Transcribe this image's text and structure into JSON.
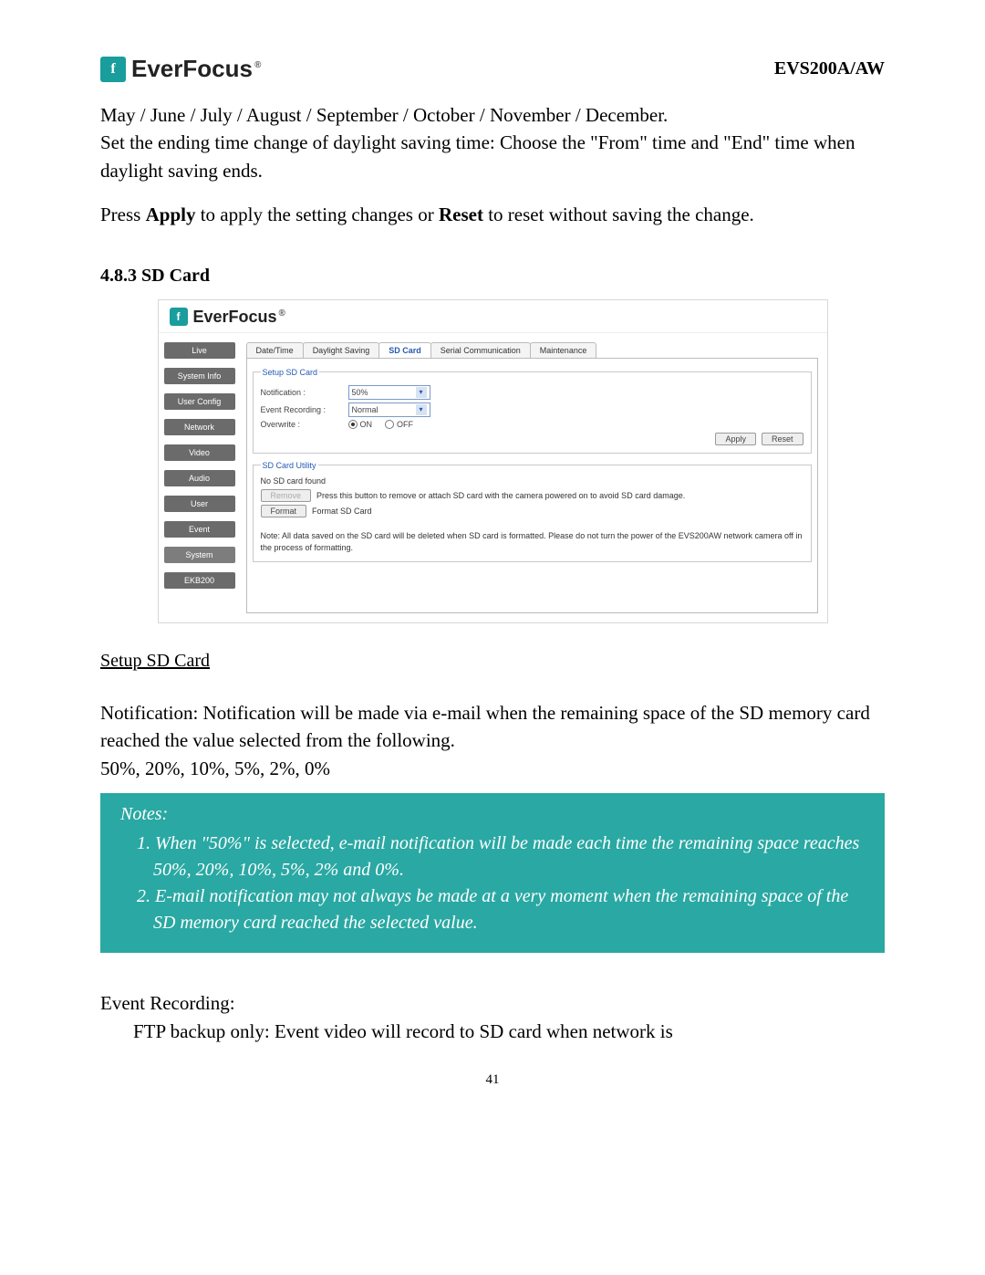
{
  "header": {
    "brand": "EverFocus",
    "model": "EVS200A/AW"
  },
  "text": {
    "para1": "May / June / July / August / September / October / November / December.",
    "para2": "Set the ending time change of daylight saving time: Choose the \"From\" time and \"End\" time when daylight saving ends.",
    "press_pre": "Press ",
    "press_apply": "Apply",
    "press_mid": " to apply the setting changes or ",
    "press_reset": "Reset",
    "press_post": " to reset without saving the change."
  },
  "section": {
    "number": "4.8.3",
    "title": "SD Card"
  },
  "screenshot": {
    "brand": "EverFocus",
    "sidebar": {
      "items": [
        {
          "label": "Live"
        },
        {
          "label": "System Info"
        },
        {
          "label": "User Config"
        },
        {
          "label": "Network"
        },
        {
          "label": "Video"
        },
        {
          "label": "Audio"
        },
        {
          "label": "User"
        },
        {
          "label": "Event"
        },
        {
          "label": "System"
        },
        {
          "label": "EKB200"
        }
      ]
    },
    "tabs": {
      "items": [
        {
          "label": "Date/Time"
        },
        {
          "label": "Daylight Saving"
        },
        {
          "label": "SD Card"
        },
        {
          "label": "Serial Communication"
        },
        {
          "label": "Maintenance"
        }
      ],
      "active_index": 2
    },
    "setup": {
      "legend": "Setup SD Card",
      "notification_label": "Notification :",
      "notification_value": "50%",
      "event_recording_label": "Event Recording :",
      "event_recording_value": "Normal",
      "overwrite_label": "Overwrite :",
      "overwrite_on": "ON",
      "overwrite_off": "OFF",
      "apply_label": "Apply",
      "reset_label": "Reset"
    },
    "utility": {
      "legend": "SD Card Utility",
      "no_card": "No SD card found",
      "remove_label": "Remove",
      "remove_desc": "Press this button to remove or attach SD card with the camera powered on to avoid SD card damage.",
      "format_label": "Format",
      "format_desc": "Format SD Card",
      "note": "Note: All data saved on the SD card will be deleted when SD card is formatted. Please do not turn the power of the EVS200AW network camera off in the process of formatting."
    }
  },
  "subhead1": "Setup SD Card",
  "notification_para1": "Notification: Notification will be made via e-mail when the remaining space of the SD memory card reached the value selected from the following.",
  "notification_para2": "50%, 20%, 10%, 5%, 2%, 0%",
  "notes": {
    "title": "Notes:",
    "item1": "1. When \"50%\" is selected, e-mail notification will be made each time the remaining space reaches 50%, 20%, 10%, 5%, 2% and 0%.",
    "item2": "2. E-mail notification may not always be made at a very moment when the remaining space of the SD memory card reached the selected value."
  },
  "event_heading": "Event Recording:",
  "event_para": "FTP backup only: Event video will record to SD card when network is",
  "page_number": "41"
}
